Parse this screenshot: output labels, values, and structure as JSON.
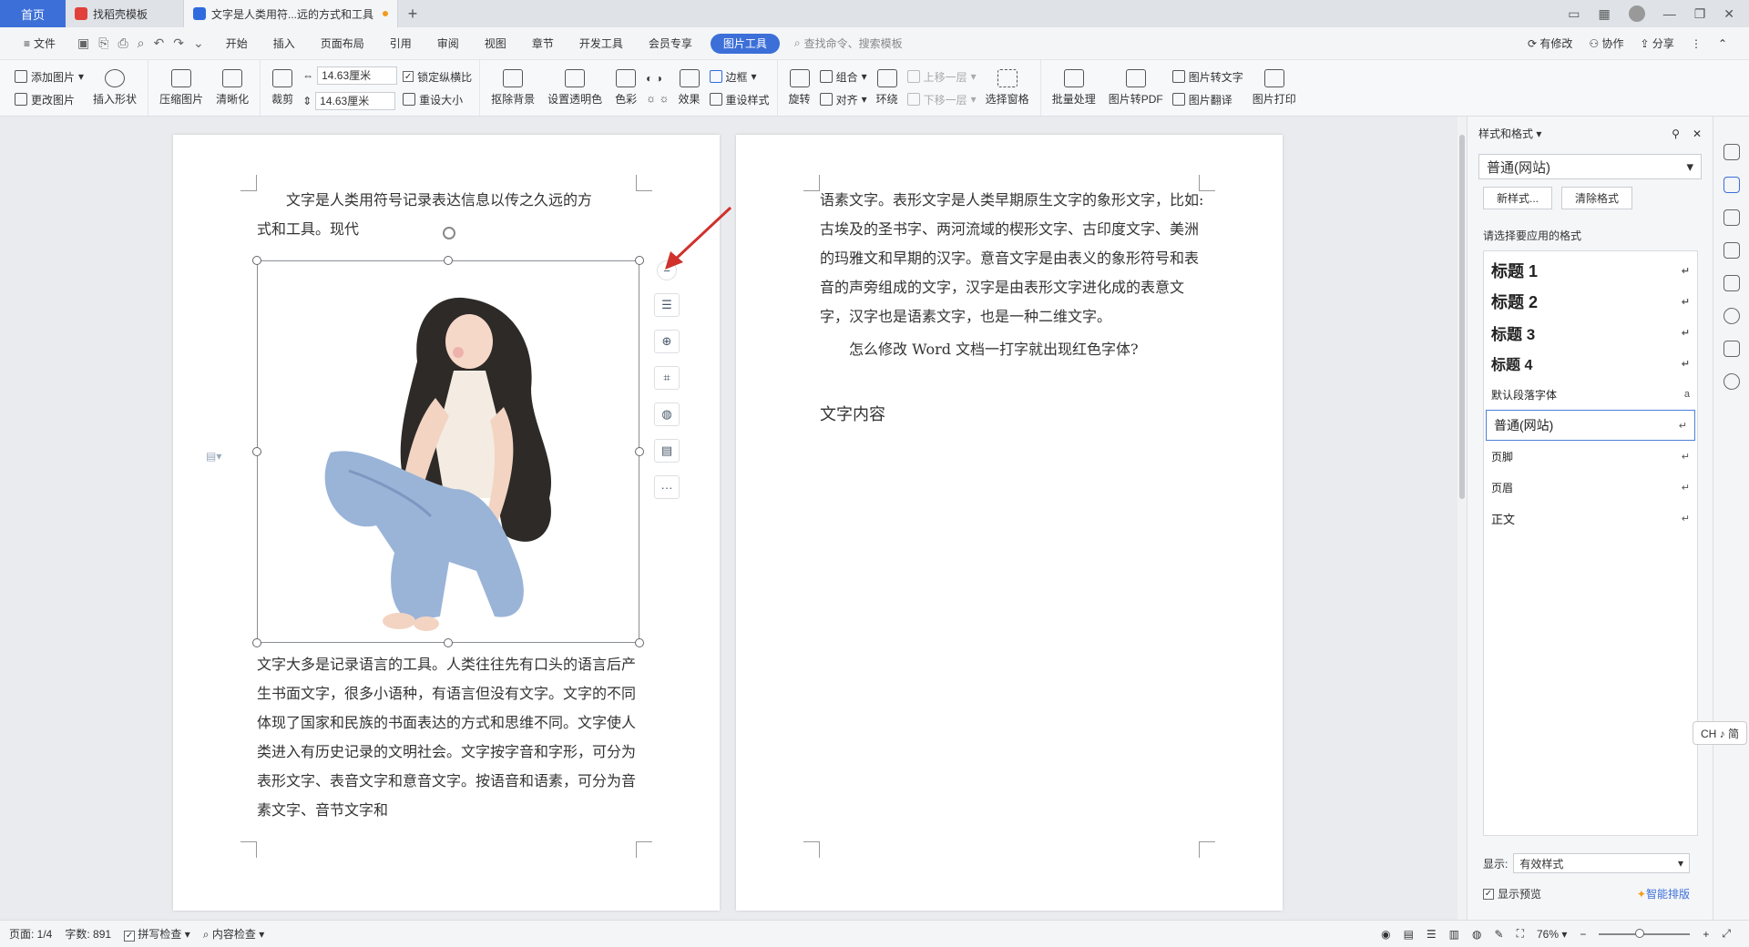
{
  "tabs": {
    "home": "首页",
    "template": "找稻壳模板",
    "doc": "文字是人类用符...远的方式和工具"
  },
  "menu": {
    "file": "文件",
    "items": [
      "开始",
      "插入",
      "页面布局",
      "引用",
      "审阅",
      "视图",
      "章节",
      "开发工具",
      "会员专享"
    ],
    "active": "图片工具",
    "search": "查找命令、搜索模板",
    "has_changes": "有修改",
    "collab": "协作",
    "share": "分享"
  },
  "ribbon": {
    "add_image": "添加图片",
    "change_image": "更改图片",
    "insert_shape": "插入形状",
    "compress": "压缩图片",
    "sharpen": "清晰化",
    "crop": "裁剪",
    "width": "14.63厘米",
    "height": "14.63厘米",
    "lock_ratio": "锁定纵横比",
    "reset_size": "重设大小",
    "remove_bg": "抠除背景",
    "set_transparent": "设置透明色",
    "color": "色彩",
    "effects": "效果",
    "border": "边框",
    "reset_style": "重设样式",
    "rotate": "旋转",
    "group": "组合",
    "align": "对齐",
    "wrap": "环绕",
    "move_up": "上移一层",
    "move_down": "下移一层",
    "select_pane": "选择窗格",
    "batch": "批量处理",
    "to_pdf": "图片转PDF",
    "to_text": "图片转文字",
    "translate": "图片翻译",
    "print": "图片打印"
  },
  "page1": {
    "line1": "文字是人类用符号记录表达信息以传之久远的方",
    "line2": "式和工具。现代",
    "para2": "文字大多是记录语言的工具。人类往往先有口头的语言后产生书面文字，很多小语种，有语言但没有文字。文字的不同体现了国家和民族的书面表达的方式和思维不同。文字使人类进入有历史记录的文明社会。文字按字音和字形，可分为表形文字、表音文字和意音文字。按语音和语素，可分为音素文字、音节文字和"
  },
  "page2": {
    "para1": "语素文字。表形文字是人类早期原生文字的象形文字，比如:古埃及的圣书字、两河流域的楔形文字、古印度文字、美洲的玛雅文和早期的汉字。意音文字是由表义的象形符号和表音的声旁组成的文字，汉字是由表形文字进化成的表意文字，汉字也是语素文字，也是一种二维文字。",
    "para2": "怎么修改 Word 文档一打字就出现红色字体?",
    "para3": "文字内容"
  },
  "style_panel": {
    "title": "样式和格式",
    "current": "普通(网站)",
    "new_style": "新样式...",
    "clear_format": "清除格式",
    "prompt": "请选择要应用的格式",
    "styles": [
      {
        "name": "标题  1",
        "mark": "↵"
      },
      {
        "name": "标题  2",
        "mark": "↵"
      },
      {
        "name": "标题  3",
        "mark": "↵"
      },
      {
        "name": "标题  4",
        "mark": "↵"
      },
      {
        "name": "默认段落字体",
        "mark": "a"
      },
      {
        "name": "普通(网站)",
        "mark": "↵"
      },
      {
        "name": "页脚",
        "mark": "↵"
      },
      {
        "name": "页眉",
        "mark": "↵"
      },
      {
        "name": "正文",
        "mark": "↵"
      }
    ],
    "show_label": "显示:",
    "show_value": "有效样式",
    "preview": "显示预览",
    "smart": "智能排版"
  },
  "ime": "CH ♪ 简",
  "status": {
    "page": "页面: 1/4",
    "words": "字数: 891",
    "spell": "拼写检查",
    "content_check": "内容检查",
    "zoom": "76%"
  },
  "colors": {
    "accent": "#3c6fd8",
    "arrow": "#d0312d"
  }
}
